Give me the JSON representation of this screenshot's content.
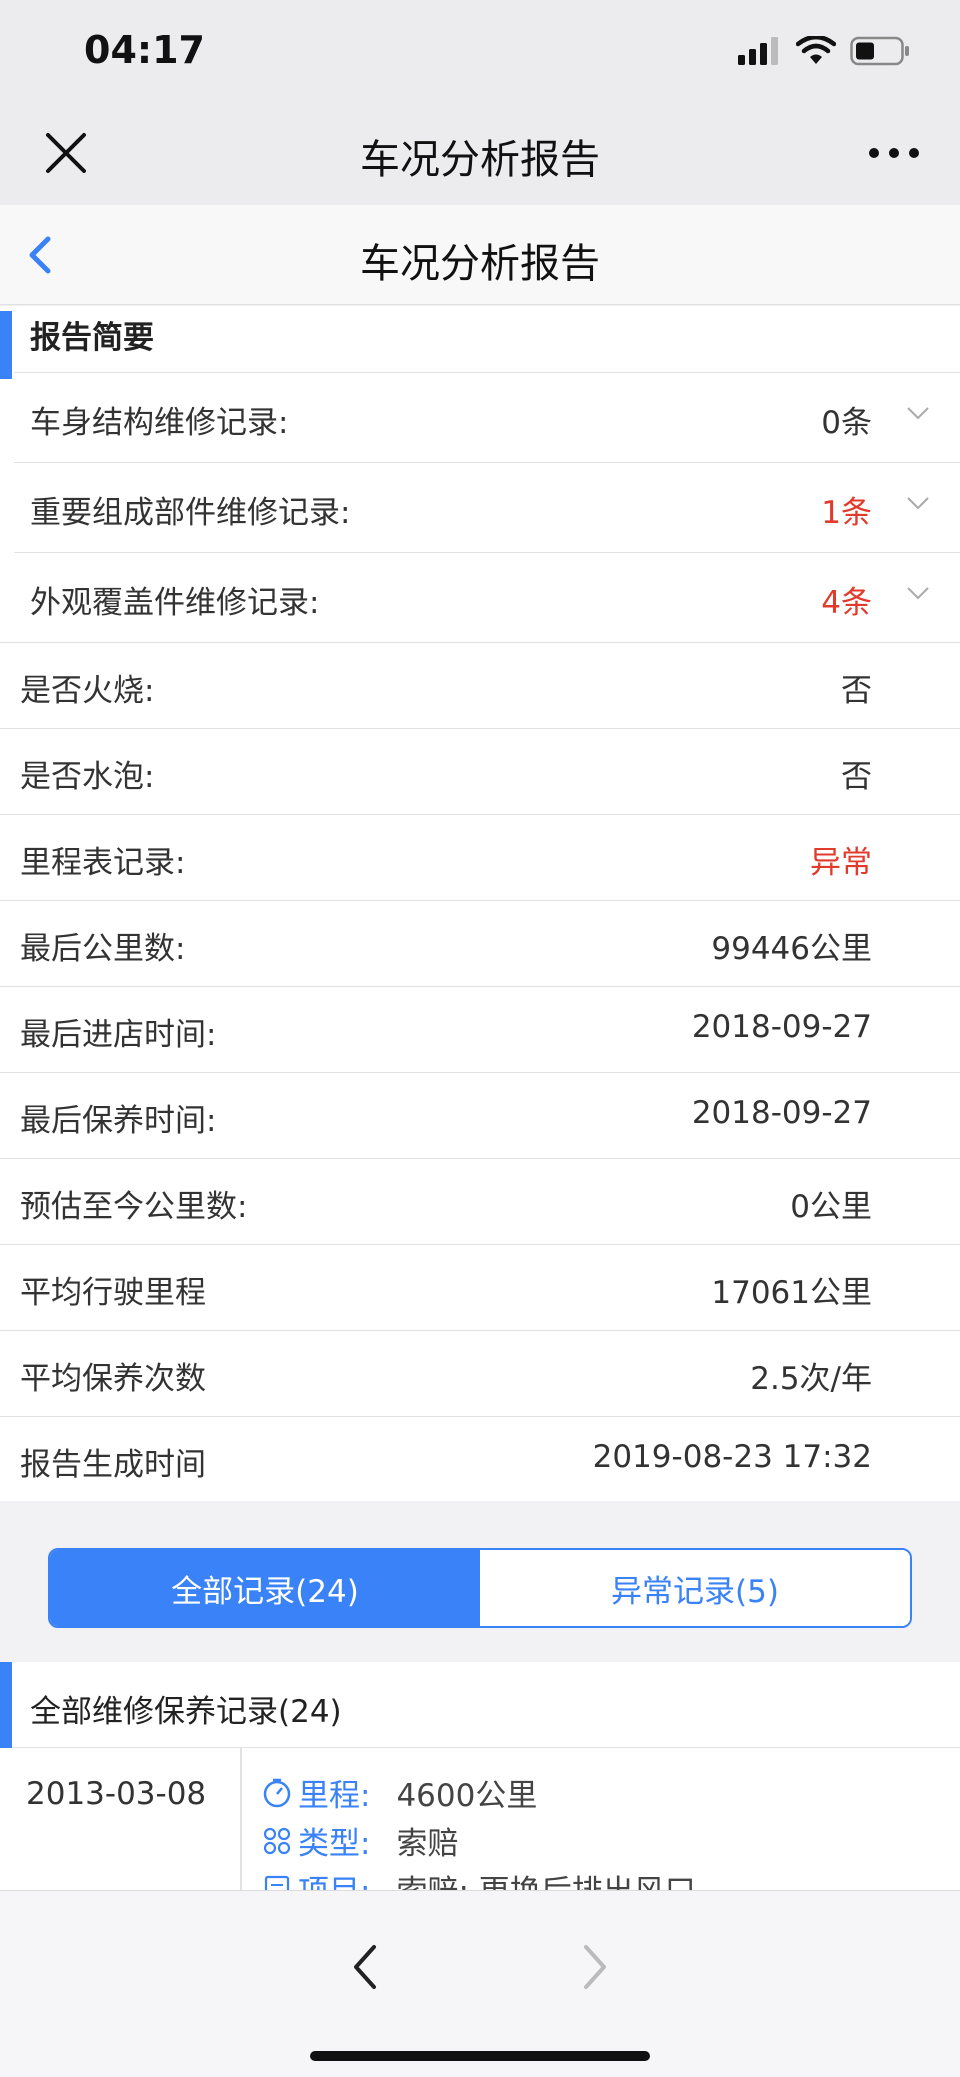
{
  "status": {
    "time": "04:17"
  },
  "wechat": {
    "title": "车况分析报告"
  },
  "app": {
    "title": "车况分析报告"
  },
  "summary": {
    "heading": "报告简要",
    "expandable": [
      {
        "label": "车身结构维修记录:",
        "value": "0条",
        "alert": false
      },
      {
        "label": "重要组成部件维修记录:",
        "value": "1条",
        "alert": true
      },
      {
        "label": "外观覆盖件维修记录:",
        "value": "4条",
        "alert": true
      }
    ],
    "rows": [
      {
        "label": "是否火烧:",
        "value": "否"
      },
      {
        "label": "是否水泡:",
        "value": "否"
      },
      {
        "label": "里程表记录:",
        "value": "异常"
      },
      {
        "label": "最后公里数:",
        "value": "99446公里"
      },
      {
        "label": "最后进店时间:",
        "value": "2018-09-27"
      },
      {
        "label": "最后保养时间:",
        "value": "2018-09-27"
      },
      {
        "label": "预估至今公里数:",
        "value": "0公里"
      },
      {
        "label": "平均行驶里程",
        "value": "17061公里"
      },
      {
        "label": "平均保养次数",
        "value": "2.5次/年"
      },
      {
        "label": "报告生成时间",
        "value": "2019-08-23 17:32"
      }
    ]
  },
  "tabs": {
    "all": "全部记录(24)",
    "abnormal": "异常记录(5)"
  },
  "records": {
    "heading": "全部维修保养记录(24)",
    "first": {
      "date": "2013-03-08",
      "mileage_key": "里程:",
      "mileage_val": "4600公里",
      "type_key": "类型:",
      "type_val": "索赔",
      "item_key": "项目:",
      "item_val": "索赔: 更换后排出风口..."
    }
  },
  "colors": {
    "accent": "#3a82f7",
    "alert": "#e03b2d"
  }
}
